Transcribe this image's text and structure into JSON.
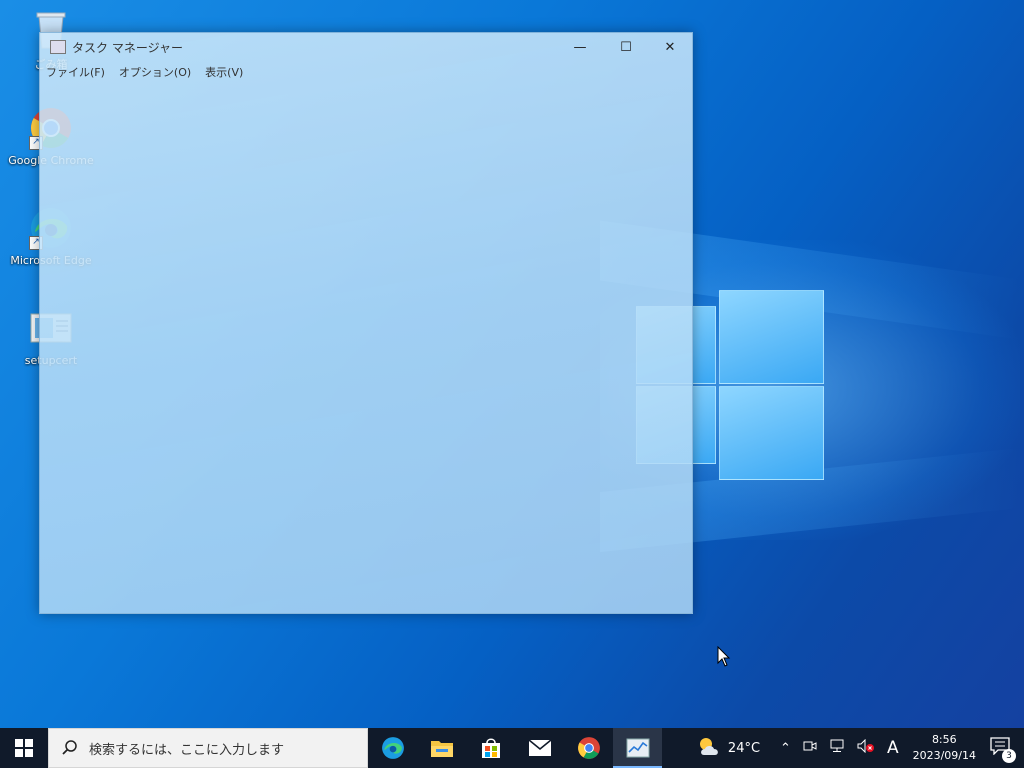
{
  "desktop": {
    "icons": [
      {
        "label": "ごみ箱",
        "icon": "recycle-bin-icon"
      },
      {
        "label": "Google Chrome",
        "icon": "chrome-icon"
      },
      {
        "label": "Microsoft Edge",
        "icon": "edge-icon"
      },
      {
        "label": "setupcert",
        "icon": "app-file-icon"
      }
    ]
  },
  "window": {
    "title": "タスク マネージャー",
    "controls": {
      "minimize": "—",
      "maximize": "☐",
      "close": "✕"
    },
    "menu": [
      "ファイル(F)",
      "オプション(O)",
      "表示(V)"
    ]
  },
  "taskbar": {
    "search_placeholder": "検索するには、ここに入力します",
    "apps": [
      "edge-icon",
      "file-explorer-icon",
      "store-icon",
      "mail-icon",
      "chrome-icon",
      "task-manager-icon"
    ],
    "weather": "24°C",
    "ime": "A",
    "time": "8:56",
    "date": "2023/09/14",
    "notification_count": "3"
  },
  "colors": {
    "accent": "#0078d7",
    "taskbar": "#101a2a"
  }
}
